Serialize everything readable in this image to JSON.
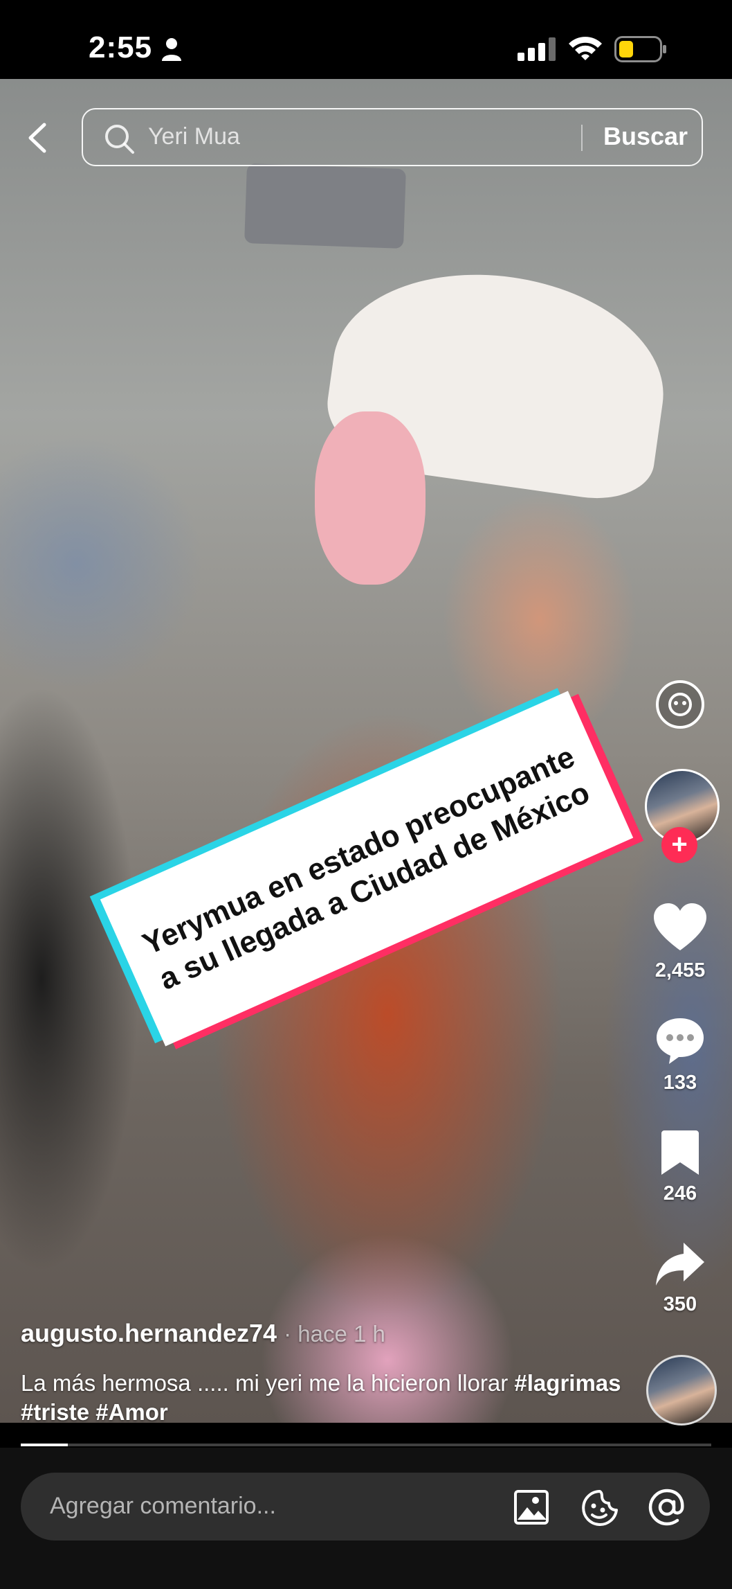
{
  "status_bar": {
    "time": "2:55"
  },
  "search": {
    "query": "Yeri Mua",
    "button_label": "Buscar"
  },
  "banner": {
    "line1": "Yerymua en estado preocupante",
    "line2": "a su llegada a Ciudad de México"
  },
  "side_rail": {
    "likes": "2,455",
    "comments": "133",
    "saves": "246",
    "shares": "350"
  },
  "post": {
    "author": "augusto.hernandez74",
    "time": "· hace 1 h",
    "caption_text": "La más hermosa ..... mi yeri me la hicieron llorar ",
    "hashtags": [
      "#lagrimas",
      "#triste",
      "#Amor"
    ],
    "progress": 0.068
  },
  "comment_bar": {
    "placeholder": "Agregar comentario..."
  },
  "colors": {
    "follow": "#fe2c55",
    "banner_cyan": "#2ad4e6",
    "banner_pink": "#ff2e63",
    "battery_low": "#ffd60a"
  },
  "icons": [
    "back-icon",
    "search-icon",
    "person-icon",
    "signal-icon",
    "wifi-icon",
    "battery-icon",
    "heart-icon",
    "comment-icon",
    "bookmark-icon",
    "share-icon",
    "image-icon",
    "emoji-icon",
    "at-icon"
  ]
}
